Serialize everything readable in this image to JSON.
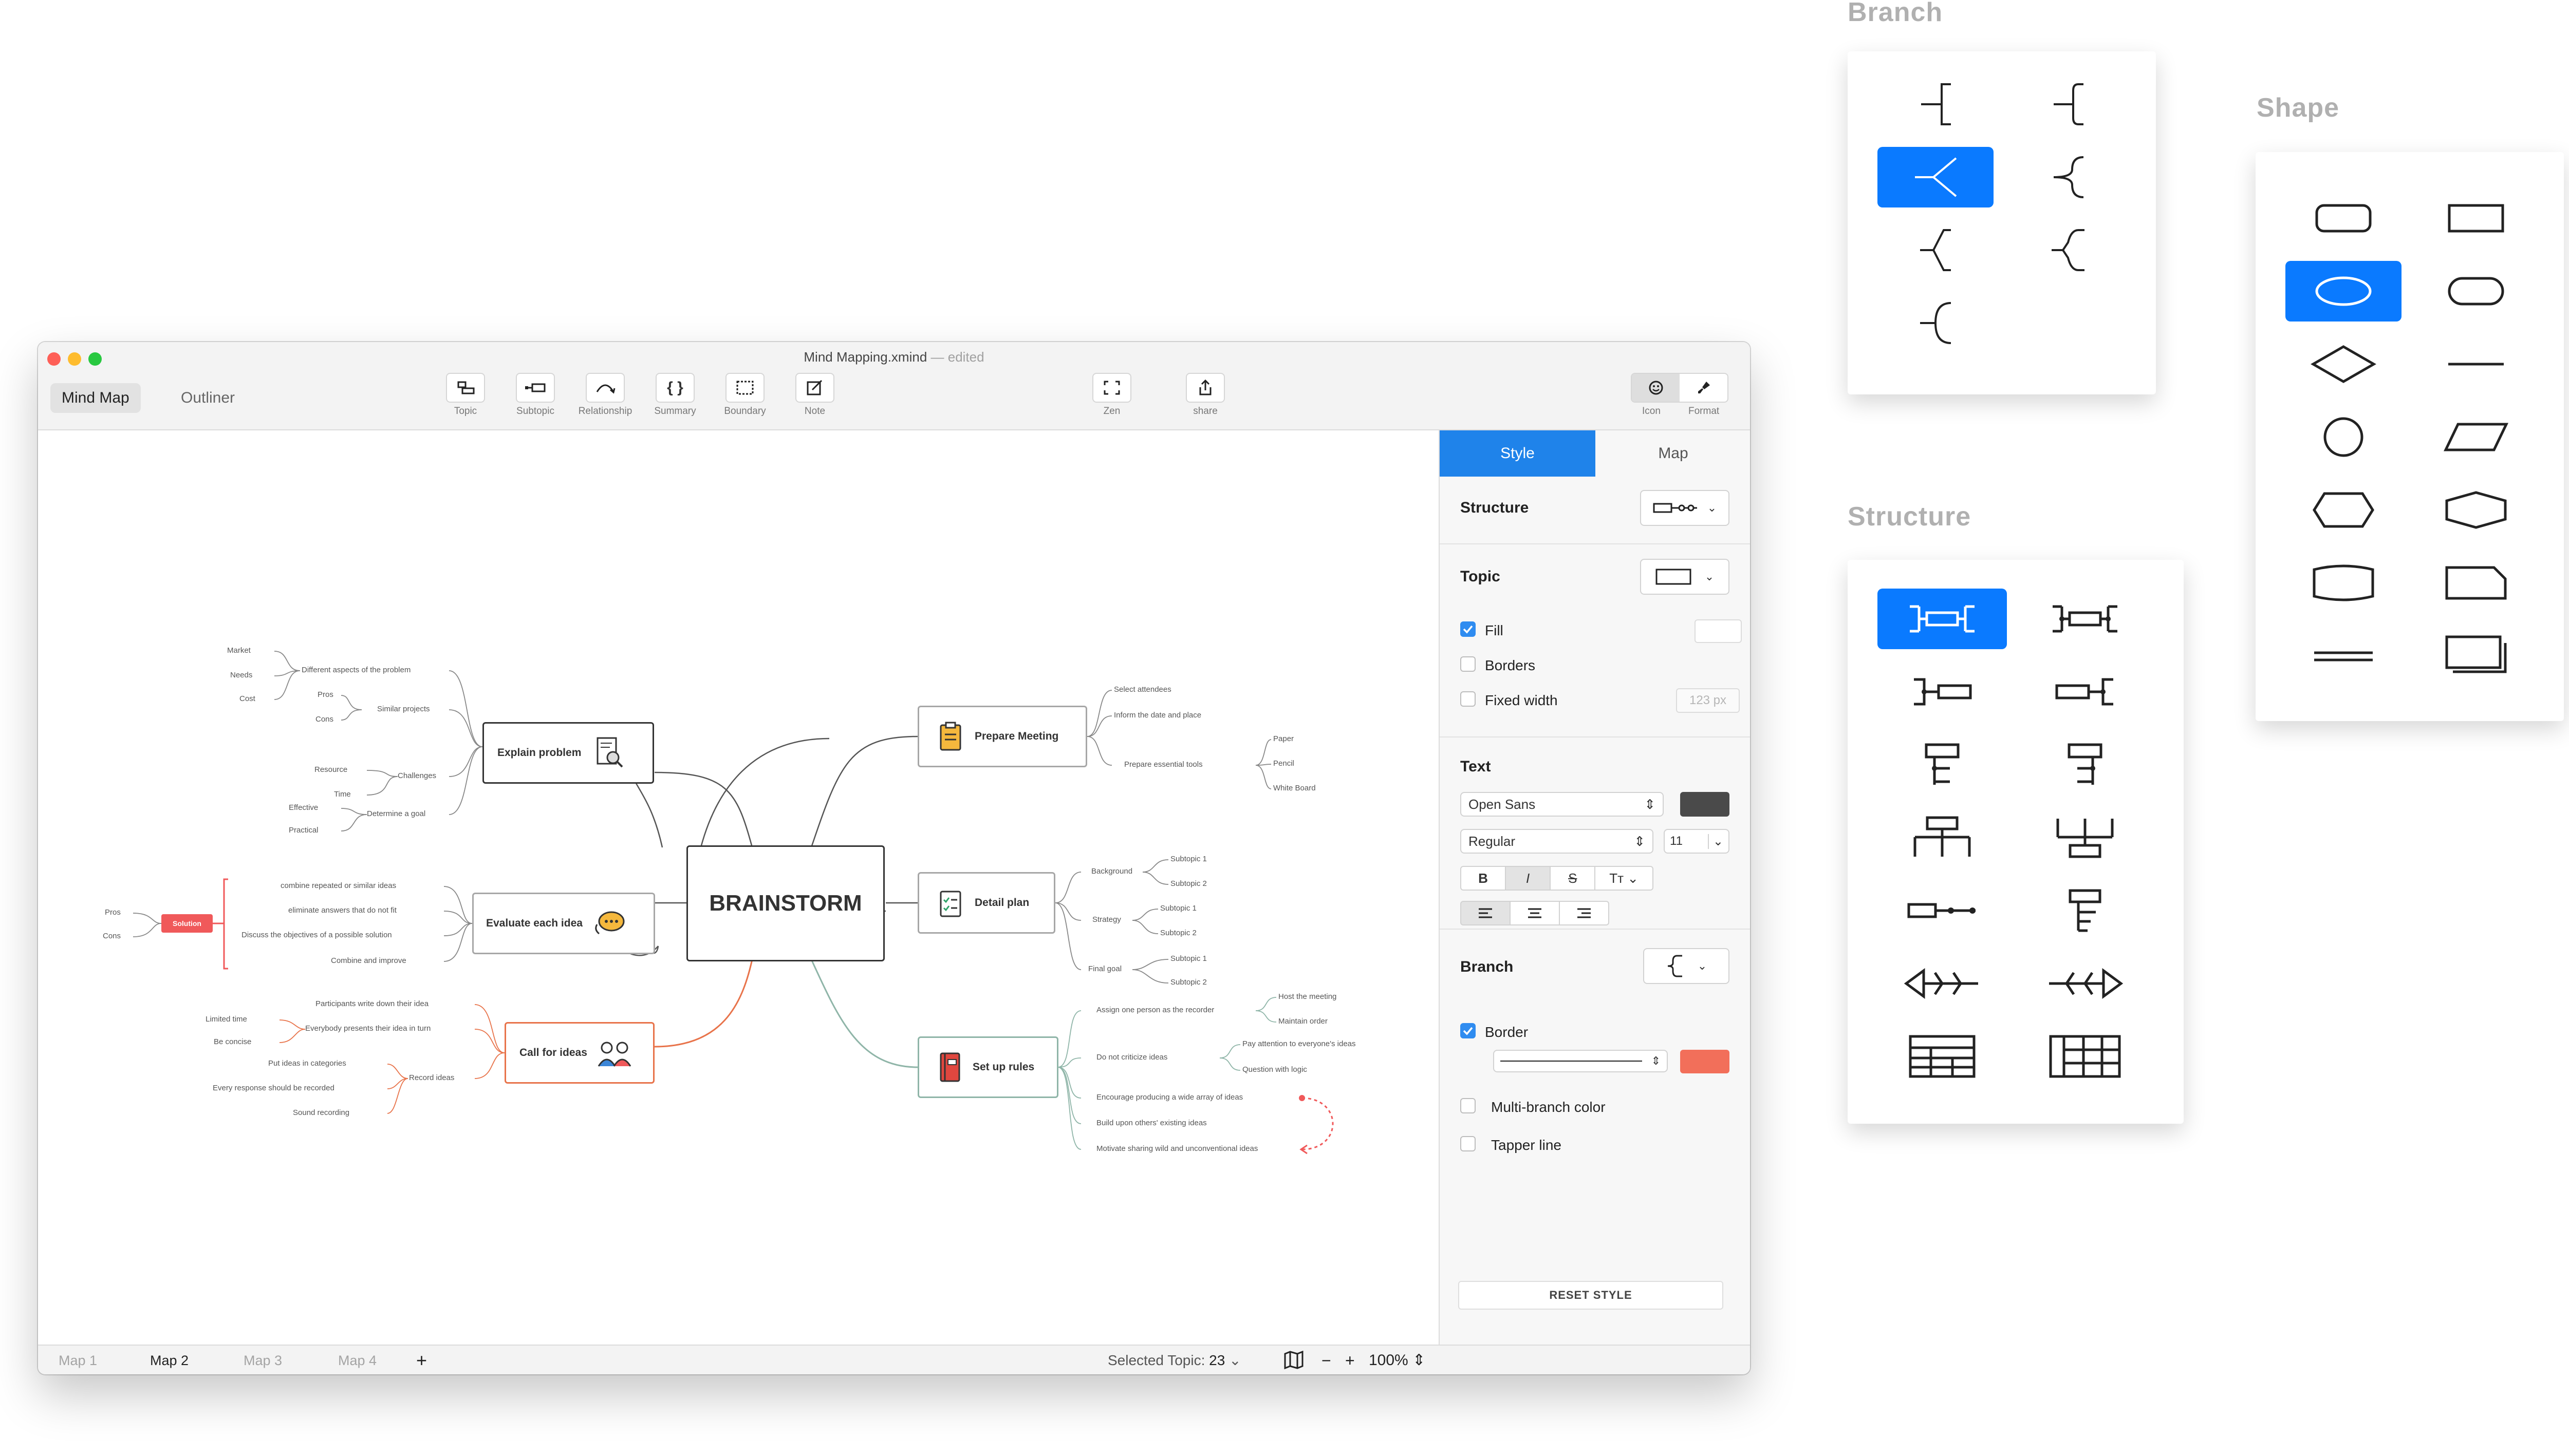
{
  "window": {
    "title": "Mind Mapping.xmind",
    "title_status": "— edited",
    "view_tabs": [
      "Mind Map",
      "Outliner"
    ],
    "active_view": "Mind Map"
  },
  "toolbar": {
    "topic": "Topic",
    "subtopic": "Subtopic",
    "relationship": "Relationship",
    "summary": "Summary",
    "boundary": "Boundary",
    "note": "Note",
    "zen": "Zen",
    "share": "share",
    "icon": "Icon",
    "format": "Format"
  },
  "panel": {
    "tabs": [
      "Style",
      "Map"
    ],
    "active_tab": "Style",
    "structure_label": "Structure",
    "topic_label": "Topic",
    "fill_label": "Fill",
    "fill_checked": true,
    "borders_label": "Borders",
    "borders_checked": false,
    "fixed_width_label": "Fixed width",
    "fixed_width_checked": false,
    "fixed_width_placeholder": "123 px",
    "text_label": "Text",
    "font_family": "Open Sans",
    "font_weight": "Regular",
    "font_size": "11",
    "text_color": "#4a4a4a",
    "bold": "B",
    "italic": "I",
    "strike": "S",
    "case": "Tт",
    "branch_label": "Branch",
    "border_label": "Border",
    "border_checked": true,
    "border_color": "#f26f5a",
    "multi_branch_label": "Multi-branch color",
    "multi_branch_checked": false,
    "tapper_label": "Tapper line",
    "tapper_checked": false,
    "reset_label": "RESET STYLE"
  },
  "statusbar": {
    "maps": [
      "Map 1",
      "Map 2",
      "Map 3",
      "Map 4"
    ],
    "active_map": "Map 2",
    "add": "+",
    "selected_label": "Selected Topic:",
    "selected_count": "23",
    "minus": "−",
    "plus": "+",
    "zoom": "100%"
  },
  "mindmap": {
    "central": "BRAINSTORM",
    "explain": {
      "title": "Explain problem",
      "sub": [
        "Different aspects of the problem",
        "Similar projects",
        "Challenges",
        "Determine a goal"
      ],
      "leaves": [
        "Market",
        "Needs",
        "Cost",
        "Pros",
        "Cons",
        "Resource",
        "Time",
        "Effective",
        "Practical"
      ]
    },
    "evaluate": {
      "title": "Evaluate each idea",
      "sub": [
        "combine repeated or similar ideas",
        "eliminate answers that do not fit",
        "Discuss the objectives of a possible solution",
        "Combine and improve"
      ],
      "solution": "Solution",
      "leaves": [
        "Pros",
        "Cons"
      ]
    },
    "call": {
      "title": "Call for ideas",
      "sub": [
        "Participants write down their idea",
        "Everybody presents their idea in turn",
        "Record ideas"
      ],
      "leaves": [
        "Limited time",
        "Be concise",
        "Put ideas in categories",
        "Every response should be recorded",
        "Sound recording"
      ]
    },
    "prepare": {
      "title": "Prepare Meeting",
      "sub": [
        "Select attendees",
        "Inform the date and place",
        "Prepare essential tools"
      ],
      "leaves": [
        "Paper",
        "Pencil",
        "White Board"
      ]
    },
    "detail": {
      "title": "Detail plan",
      "sub": [
        "Background",
        "Strategy",
        "Final goal"
      ],
      "leaves": [
        "Subtopic 1",
        "Subtopic 2",
        "Subtopic 1",
        "Subtopic 2",
        "Subtopic 1",
        "Subtopic 2"
      ]
    },
    "rules": {
      "title": "Set up rules",
      "sub": [
        "Assign one person as the recorder",
        "Do not criticize ideas",
        "Encourage producing a wide array of ideas",
        "Build upon others' existing ideas",
        "Motivate sharing wild and unconventional ideas"
      ],
      "leaves": [
        "Host the meeting",
        "Maintain order",
        "Pay attention to everyone's ideas",
        "Question with logic"
      ]
    }
  },
  "palettes": {
    "branch": "Branch",
    "shape": "Shape",
    "structure": "Structure"
  },
  "colors": {
    "accent": "#0a7aff",
    "call_branch": "#e8734a",
    "solution": "#f0595a"
  }
}
